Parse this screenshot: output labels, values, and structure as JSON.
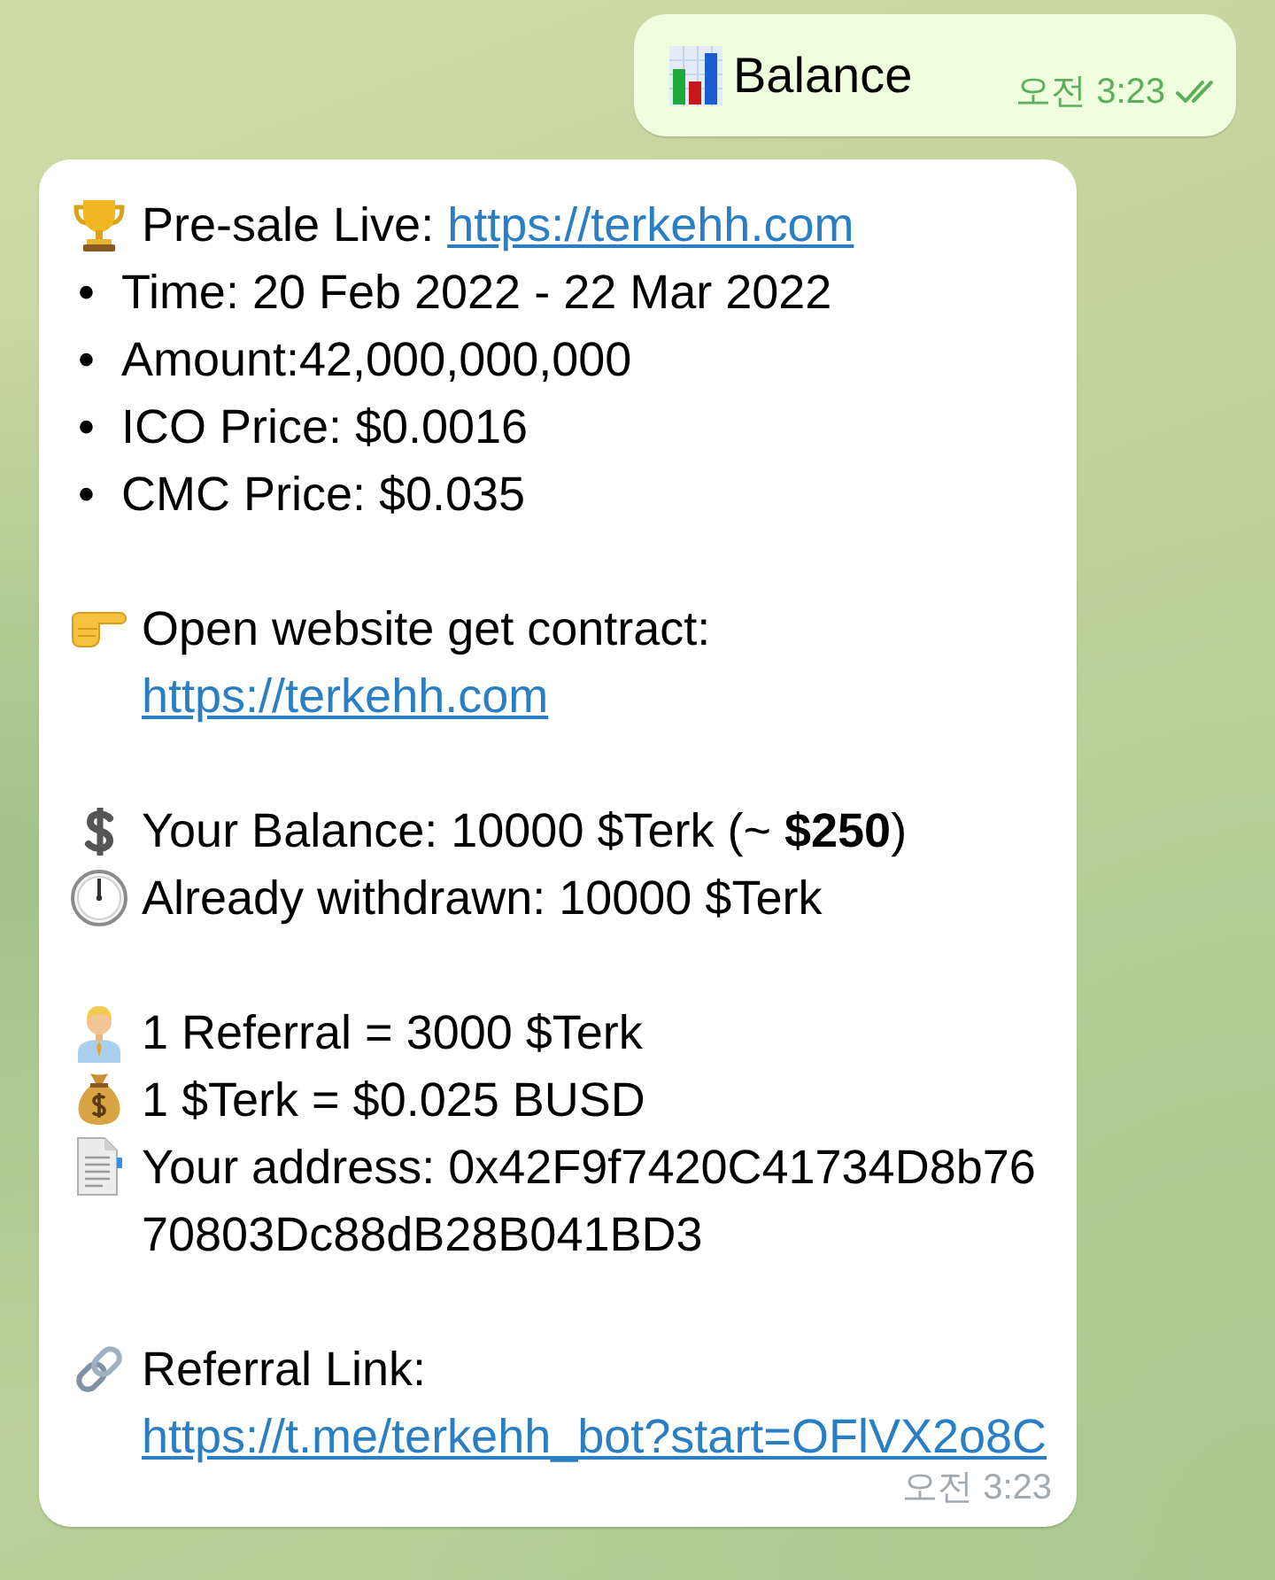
{
  "outgoing_message": {
    "text": "Balance",
    "time": "오전 3:23",
    "read": true
  },
  "incoming_message": {
    "paragraphs": [
      [
        {
          "kind": "icon",
          "text": "Pre-sale Live:",
          "link": "https://terkehh.com"
        },
        {
          "kind": "bullet",
          "bullet": "•",
          "text": "Time: 20 Feb 2022 - 22 Mar 2022"
        },
        {
          "kind": "bullet",
          "bullet": "•",
          "text": "Amount:42,000,000,000"
        },
        {
          "kind": "bullet",
          "bullet": "•",
          "text": "ICO Price: $0.0016"
        },
        {
          "kind": "bullet",
          "bullet": "•",
          "text": "CMC Price: $0.035"
        }
      ],
      [
        {
          "kind": "icon",
          "text": "Open website get contract:",
          "link": "https://terkehh.com"
        }
      ],
      [
        {
          "kind": "icon",
          "text": "Your Balance: 10000 $Terk (~ **$250**)"
        },
        {
          "kind": "icon",
          "text": "Already withdrawn: 10000 $Terk"
        }
      ],
      [
        {
          "kind": "icon",
          "text": "1 Referral = 3000 $Terk"
        },
        {
          "kind": "icon",
          "text": "1 $Terk = $0.025 BUSD"
        },
        {
          "kind": "icon",
          "text": "Your address: 0x42F9f7420C41734D8b7670803Dc88dB28B041BD3"
        }
      ],
      [
        {
          "kind": "icon",
          "text": "Referral Link:",
          "link": "https://t.me/terkehh_bot?start=OFlVX2o8C"
        }
      ]
    ],
    "time": "오전 3:23"
  }
}
